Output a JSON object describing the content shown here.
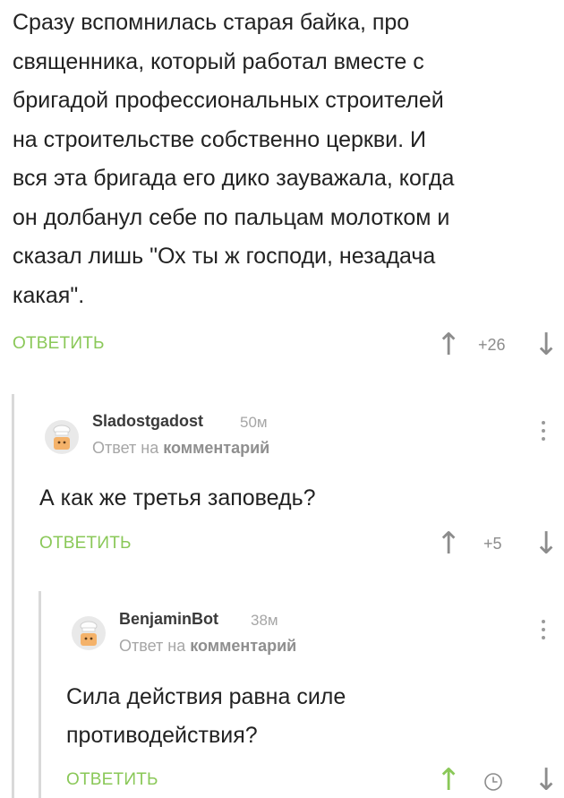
{
  "comments": [
    {
      "text": "Сразу вспомнилась старая байка, про\nсвященника, который работал вместе с\nбригадой профессиональных строителей\nна строительстве собственно церкви. И\nвся эта бригада его дико зауважала, когда\nон долбанул себе по пальцам молотком и\nсказал лишь \"Ох ты ж господи, незадача\nкакая\".",
      "reply_label": "ОТВЕТИТЬ",
      "score": "+26"
    },
    {
      "username": "Sladostgadost",
      "time": "50м",
      "reply_prefix": "Ответ на",
      "reply_target": "комментарий",
      "text": "А как же третья заповедь?",
      "reply_label": "ОТВЕТИТЬ",
      "score": "+5"
    },
    {
      "username": "BenjaminBot",
      "time": "38м",
      "reply_prefix": "Ответ на",
      "reply_target": "комментарий",
      "text": "Сила действия равна силе\nпротиводействия?",
      "reply_label": "ОТВЕТИТЬ",
      "score_icon": "clock-icon"
    }
  ],
  "icons": {
    "upvote": "arrow-up-icon",
    "downvote": "arrow-down-icon",
    "menu": "more-vertical-icon",
    "avatar": "default-avatar-icon"
  },
  "colors": {
    "accent": "#8ac858",
    "muted": "#a6a6a6",
    "thread_line": "#d9d9d9"
  }
}
